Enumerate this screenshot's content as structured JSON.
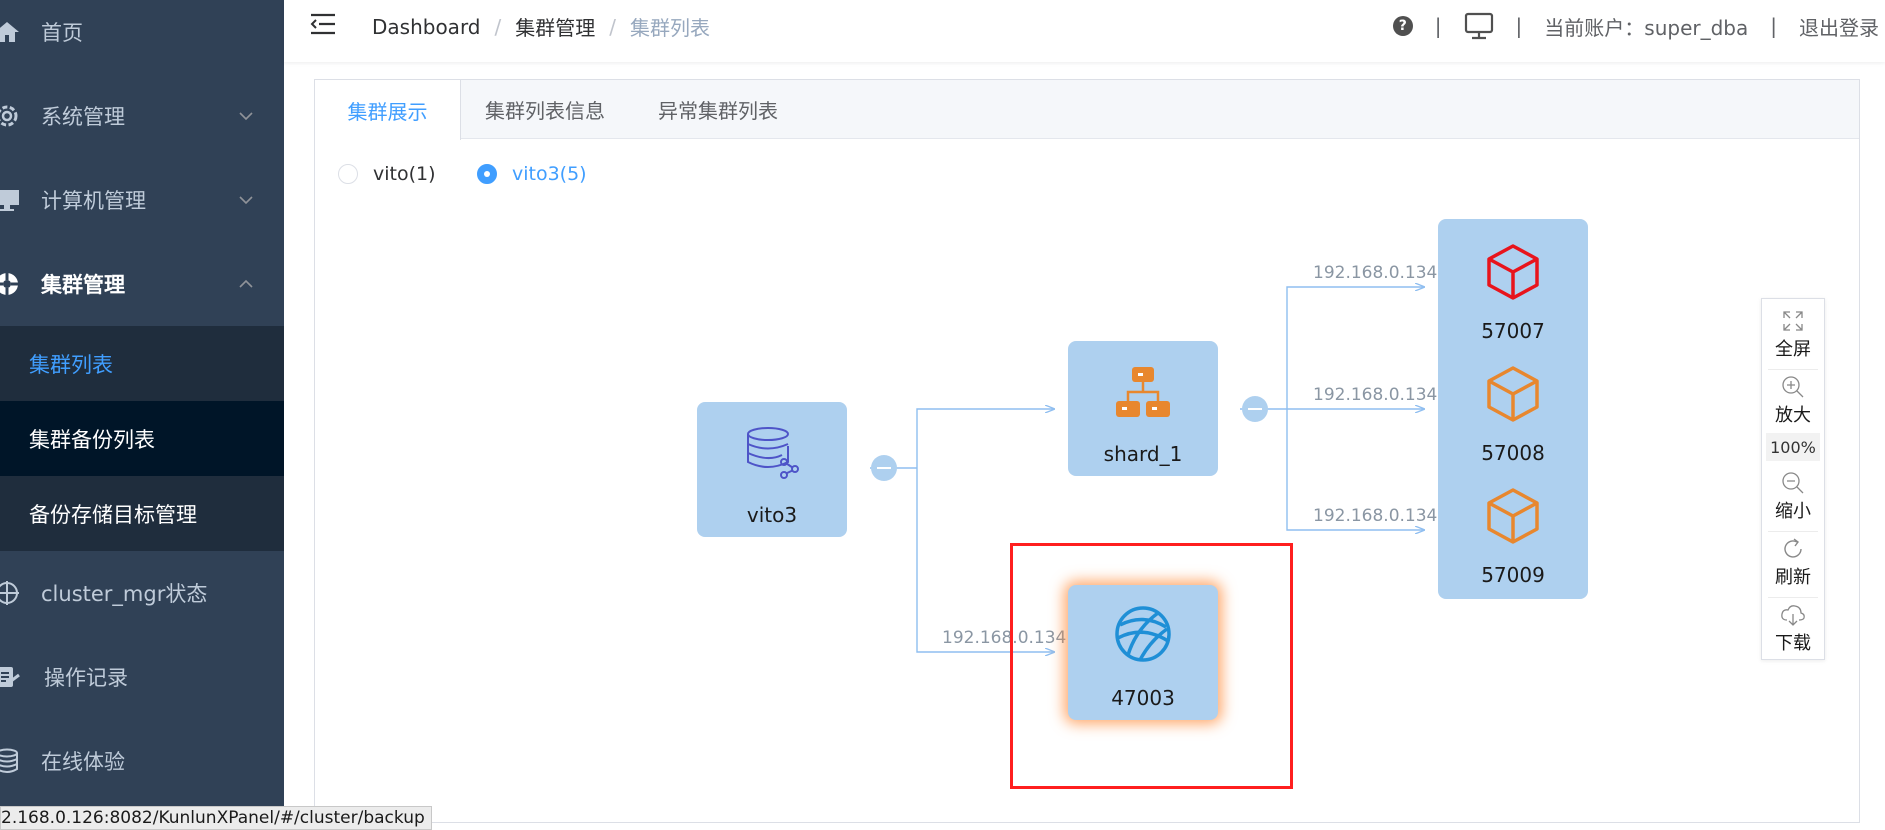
{
  "sidebar": {
    "items": [
      {
        "label": "首页",
        "icon": "home-icon"
      },
      {
        "label": "系统管理",
        "icon": "gear-icon"
      },
      {
        "label": "计算机管理",
        "icon": "monitor-icon"
      },
      {
        "label": "集群管理",
        "icon": "cluster-icon"
      }
    ],
    "sub_items": [
      {
        "label": "集群列表"
      },
      {
        "label": "集群备份列表"
      },
      {
        "label": "备份存储目标管理"
      }
    ],
    "more_items": [
      {
        "label": "cluster_mgr状态",
        "icon": "crosshair-icon"
      },
      {
        "label": "操作记录",
        "icon": "log-icon"
      },
      {
        "label": "在线体验",
        "icon": "database-icon"
      }
    ]
  },
  "header": {
    "breadcrumb": [
      "Dashboard",
      "集群管理",
      "集群列表"
    ],
    "account_label": "当前账户：super_dba",
    "logout_label": "退出登录",
    "help_glyph": "?"
  },
  "tabs": [
    "集群展示",
    "集群列表信息",
    "异常集群列表"
  ],
  "radios": [
    {
      "label": "vito(1)",
      "checked": false
    },
    {
      "label": "vito3(5)",
      "checked": true
    }
  ],
  "topology": {
    "root": {
      "label": "vito3"
    },
    "shard": {
      "label": "shard_1"
    },
    "nodes": [
      {
        "label": "57007",
        "ip": "192.168.0.134",
        "color": "#e8141c"
      },
      {
        "label": "57008",
        "ip": "192.168.0.134",
        "color": "#e8872e"
      },
      {
        "label": "57009",
        "ip": "192.168.0.134",
        "color": "#e8872e"
      }
    ],
    "computing_node": {
      "label": "47003",
      "ip": "192.168.0.134"
    }
  },
  "toolbox": {
    "fullscreen": "全屏",
    "zoom_in": "放大",
    "zoom_level": "100%",
    "zoom_out": "缩小",
    "refresh": "刷新",
    "download": "下载"
  },
  "status_url": "2.168.0.126:8082/KunlunXPanel/#/cluster/backup",
  "colors": {
    "sidebar_bg": "#304156",
    "accent": "#409eff",
    "node_bg": "#aed0ef",
    "highlight": "#ff1f1f"
  }
}
